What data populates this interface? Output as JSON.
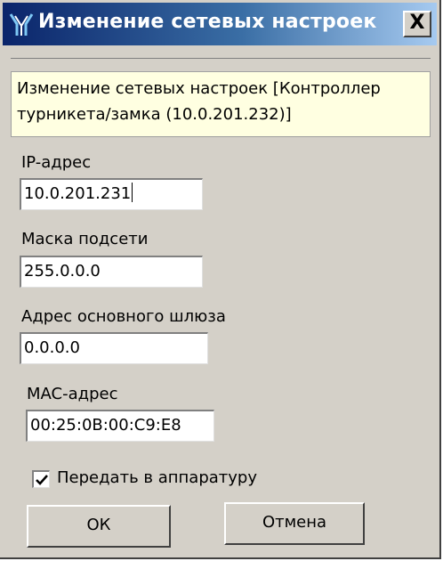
{
  "window": {
    "title": "Изменение сетевых настроек",
    "close_label": "X"
  },
  "info": {
    "text": "Изменение сетевых настроек [Контроллер турникета/замка (10.0.201.232)]"
  },
  "fields": {
    "ip_label": "IP-адрес",
    "ip_value": "10.0.201.231",
    "mask_label": "Маска подсети",
    "mask_value": "255.0.0.0",
    "gateway_label": "Адрес основного шлюза",
    "gateway_value": "0.0.0.0",
    "mac_label": "MAC-адрес",
    "mac_value": "00:25:0B:00:C9:E8"
  },
  "options": {
    "send_label": "Передать в аппаратуру",
    "send_checked": true
  },
  "buttons": {
    "ok_label": "ОК",
    "cancel_label": "Отмена"
  },
  "colors": {
    "title_bar_start": "#0a246a",
    "title_bar_end": "#a6caf0",
    "info_background": "#ffffe1",
    "dialog_background": "#d4d0c8"
  },
  "icons": {
    "title": "turnstile-app-icon",
    "check": "check-mark-icon"
  }
}
